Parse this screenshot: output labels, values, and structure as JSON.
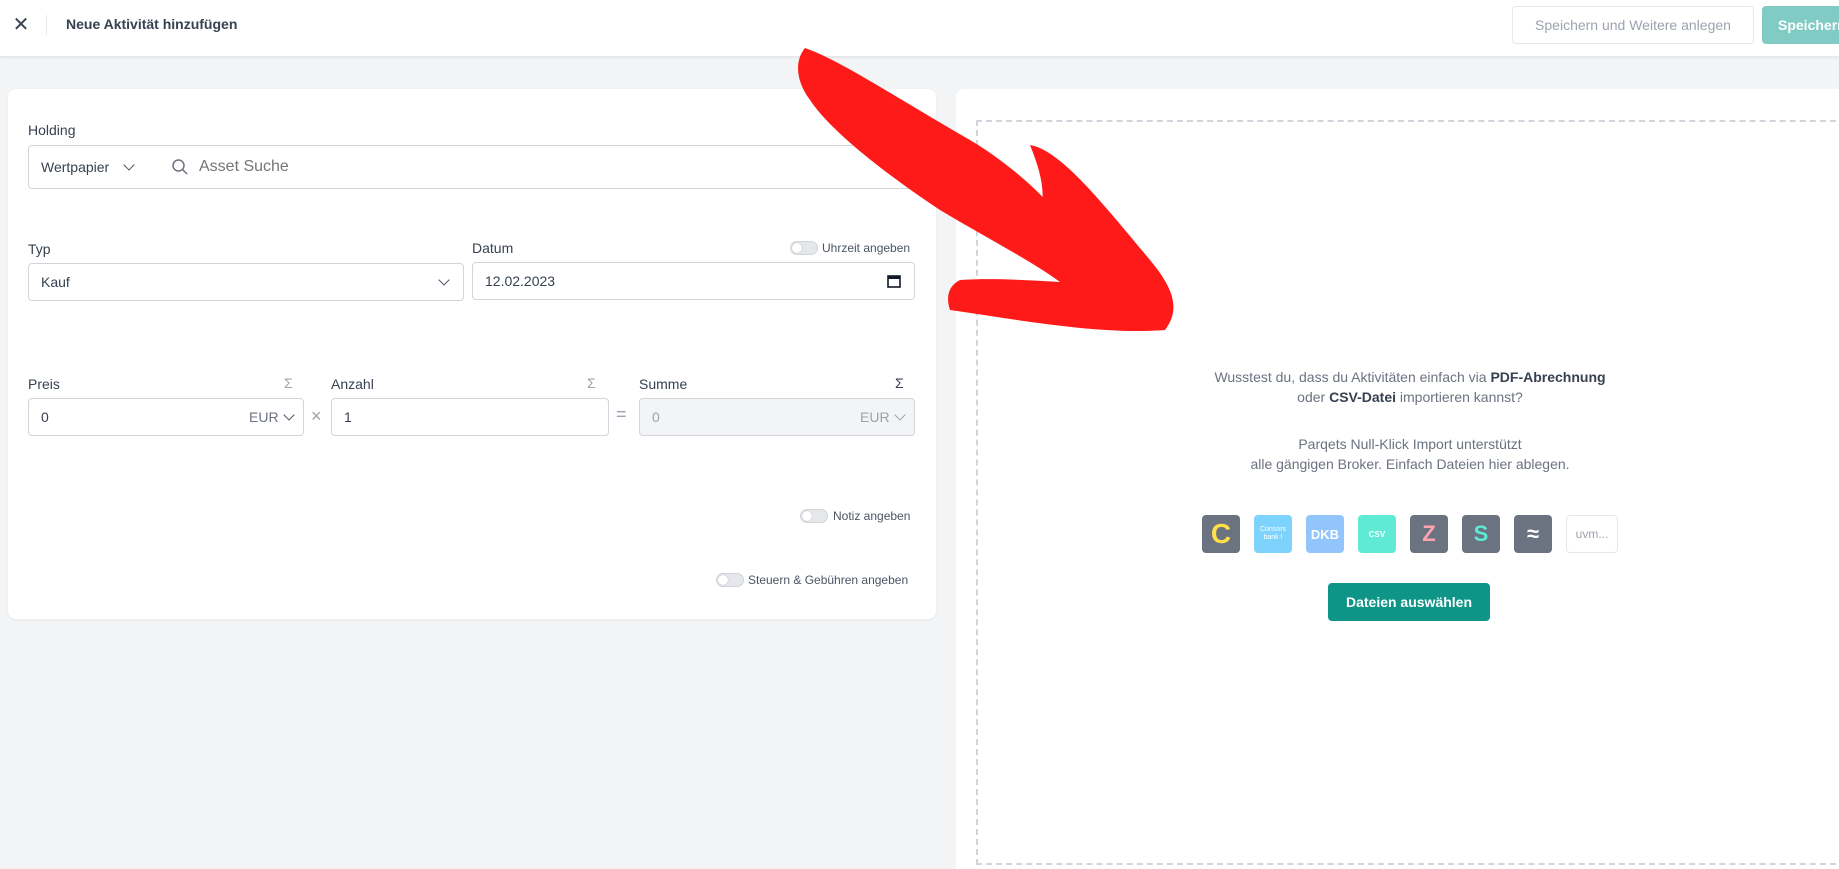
{
  "header": {
    "close_icon": "close-icon",
    "title": "Neue Aktivität hinzufügen",
    "save_more_label": "Speichern und Weitere anlegen",
    "save_label": "Speichern"
  },
  "form": {
    "holding": {
      "label": "Holding",
      "asset_type": "Wertpapier",
      "search_placeholder": "Asset Suche"
    },
    "typ": {
      "label": "Typ",
      "value": "Kauf"
    },
    "datum": {
      "label": "Datum",
      "value": "12.02.2023",
      "time_toggle_label": "Uhrzeit angeben"
    },
    "preis": {
      "label": "Preis",
      "value": "0",
      "currency": "EUR",
      "sigma": "Σ"
    },
    "multiply": "×",
    "anzahl": {
      "label": "Anzahl",
      "value": "1",
      "sigma": "Σ"
    },
    "equals": "=",
    "summe": {
      "label": "Summe",
      "value": "0",
      "currency": "EUR",
      "sigma": "Σ"
    },
    "note_toggle_label": "Notiz angeben",
    "fees_toggle_label": "Steuern & Gebühren angeben"
  },
  "import": {
    "line1_pre": "Wusstest du, dass du Aktivitäten einfach via ",
    "line1_bold": "PDF-Abrechnung",
    "line2_pre": "oder ",
    "line2_bold": "CSV-Datei",
    "line2_post": " importieren kannst?",
    "line3": "Parqets Null-Klick Import unterstützt",
    "line4": "alle gängigen Broker. Einfach Dateien hier ablegen.",
    "brokers": [
      {
        "name": "C",
        "color": "#6b7280",
        "text_color": "#fde047"
      },
      {
        "name": "Consors bank !",
        "color": "#7dd3fc",
        "text_color": "#ffffff"
      },
      {
        "name": "DKB",
        "color": "#93c5fd",
        "text_color": "#ffffff"
      },
      {
        "name": "CSV",
        "color": "#5eead4",
        "text_color": "#ffffff"
      },
      {
        "name": "Z",
        "color": "#6b7280",
        "text_color": "#fda4af"
      },
      {
        "name": "S",
        "color": "#6b7280",
        "text_color": "#5eead4"
      },
      {
        "name": "≈",
        "color": "#6b7280",
        "text_color": "#ffffff"
      }
    ],
    "more_label": "uvm...",
    "button_label": "Dateien auswählen"
  },
  "annotation": {
    "arrow_color": "#ff1a1a"
  }
}
